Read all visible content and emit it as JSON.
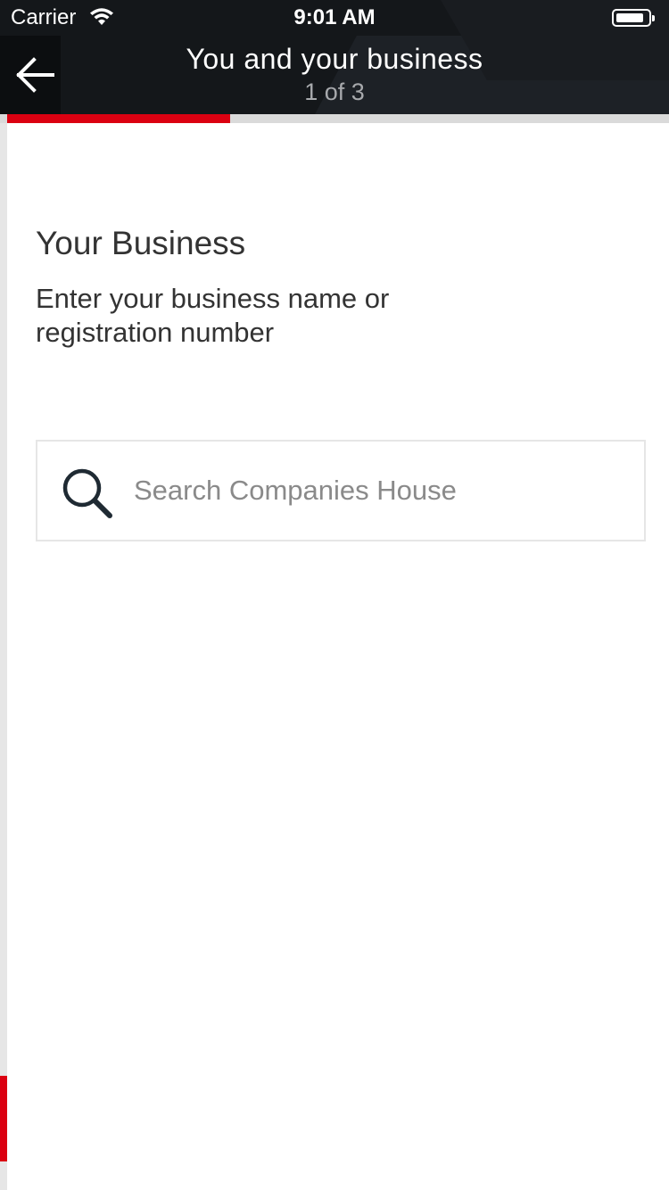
{
  "status_bar": {
    "carrier": "Carrier",
    "time": "9:01 AM"
  },
  "nav": {
    "title": "You and your business",
    "step": "1 of 3",
    "back_icon": "arrow-left-icon"
  },
  "progress": {
    "current_step": 1,
    "total_steps": 3,
    "fraction": 0.333,
    "color": "#db0011"
  },
  "section": {
    "title": "Your Business",
    "description": "Enter your business name or registration number"
  },
  "search": {
    "placeholder": "Search Companies House",
    "value": "",
    "icon": "search-icon"
  },
  "colors": {
    "header_bg": "#14171a",
    "accent": "#db0011"
  }
}
